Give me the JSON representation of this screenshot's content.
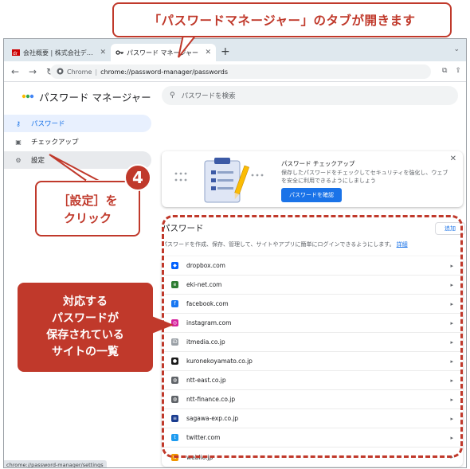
{
  "annotations": {
    "top_callout": "「パスワードマネージャー」のタブが開きます",
    "step_number": "4",
    "settings_callout_line1": "［設定］を",
    "settings_callout_line2": "クリック",
    "list_callout_line1": "対応する",
    "list_callout_line2": "パスワードが",
    "list_callout_line3": "保存されている",
    "list_callout_line4": "サイトの一覧",
    "accent_color": "#c0392b"
  },
  "browser": {
    "tabs": [
      {
        "label": "会社概要 | 株式会社デジタルアドバンテージ",
        "active": false
      },
      {
        "label": "パスワード マネージャー",
        "active": true
      }
    ],
    "new_tab": "+",
    "omnibox": {
      "scheme": "Chrome",
      "url": "chrome://password-manager/passwords"
    },
    "status_url": "chrome://password-manager/settings"
  },
  "app": {
    "title": "パスワード マネージャー",
    "search_placeholder": "パスワードを検索",
    "sidebar": [
      {
        "label": "パスワード",
        "icon": "key-icon",
        "state": "active"
      },
      {
        "label": "チェックアップ",
        "icon": "checkup-icon",
        "state": "normal"
      },
      {
        "label": "設定",
        "icon": "gear-icon",
        "state": "hover"
      }
    ],
    "checkup_card": {
      "title": "パスワード チェックアップ",
      "description": "保存したパスワードをチェックしてセキュリティを強化し、ウェブを安全に利用できるようにしましょう",
      "button": "パスワードを確認"
    },
    "passwords": {
      "heading": "パスワード",
      "add_button": "追加",
      "description": "パスワードを作成、保存、管理して、サイトやアプリに簡単にログインできるようにします。",
      "details_link": "詳細",
      "sites": [
        {
          "name": "dropbox.com",
          "color": "#0061fe",
          "glyph": "◆"
        },
        {
          "name": "eki-net.com",
          "color": "#2e7d32",
          "glyph": "e"
        },
        {
          "name": "facebook.com",
          "color": "#1877f2",
          "glyph": "f"
        },
        {
          "name": "instagram.com",
          "color": "#d6249f",
          "glyph": "◎"
        },
        {
          "name": "itmedia.co.jp",
          "color": "#9aa0a6",
          "glyph": "iD"
        },
        {
          "name": "kuronekoyamato.co.jp",
          "color": "#1a1a1a",
          "glyph": "●"
        },
        {
          "name": "ntt-east.co.jp",
          "color": "#5f6368",
          "glyph": "◍"
        },
        {
          "name": "ntt-finance.co.jp",
          "color": "#5f6368",
          "glyph": "◍"
        },
        {
          "name": "sagawa-exp.co.jp",
          "color": "#1a3c8f",
          "glyph": "≡"
        },
        {
          "name": "twitter.com",
          "color": "#1d9bf0",
          "glyph": "t"
        },
        {
          "name": "weblio.jp",
          "color": "#f29600",
          "glyph": "w"
        }
      ]
    }
  }
}
